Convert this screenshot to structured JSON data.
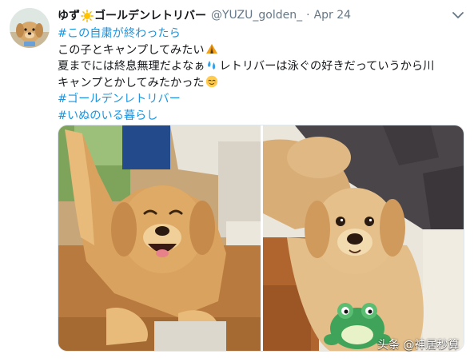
{
  "tweet": {
    "display_name": "ゆず",
    "display_name_suffix": "ゴールデンレトリバー",
    "handle": "@YUZU_golden_",
    "separator": "·",
    "time": "Apr 24",
    "lines": [
      {
        "hashtag": "#この自粛が終わったら"
      },
      {
        "text": "この子とキャンプしてみたい",
        "emoji": "tent-emoji"
      },
      {
        "text_before": "夏までには終息無理だよなぁ",
        "emoji": "sweat-droplets-emoji",
        "text_after": "レトリバーは泳ぐの好きだっていうから川"
      },
      {
        "text": "キャンプとかしてみたかった",
        "emoji": "relieved-face-emoji"
      },
      {
        "hashtag": "#ゴールデンレトリバー"
      },
      {
        "hashtag": "#いぬのいる暮らし"
      }
    ]
  },
  "media": {
    "photos": [
      {
        "subject": "smiling golden retriever on wooden table"
      },
      {
        "subject": "golden retriever puppy with green frog toy"
      }
    ]
  },
  "watermark": {
    "text": "头条 @神居秒算"
  },
  "colors": {
    "link": "#1b95e0",
    "text": "#14171a",
    "muted": "#657786"
  }
}
